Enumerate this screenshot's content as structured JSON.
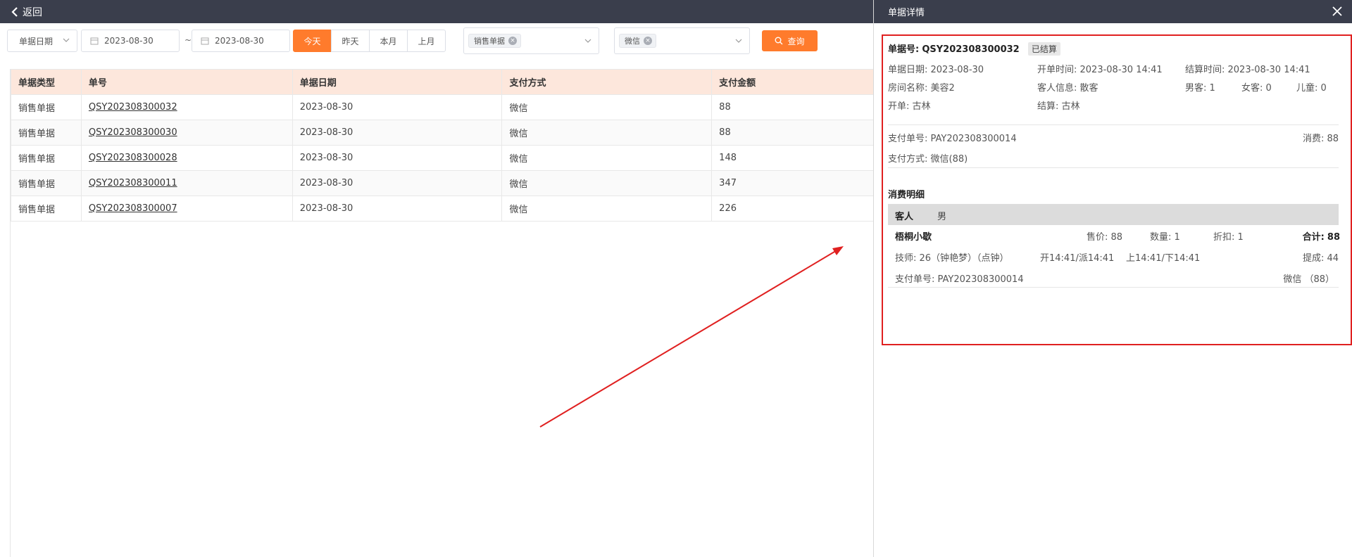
{
  "topbar": {
    "back_label": "返回"
  },
  "filters": {
    "date_type": "单据日期",
    "date_from": "2023-08-30",
    "date_sep": "~",
    "date_to": "2023-08-30",
    "quick": [
      "今天",
      "昨天",
      "本月",
      "上月"
    ],
    "doc_type_tag": "销售单据",
    "pay_tag": "微信",
    "query_label": "查询"
  },
  "table": {
    "headers": [
      "单据类型",
      "单号",
      "单据日期",
      "支付方式",
      "支付金额"
    ],
    "rows": [
      [
        "销售单据",
        "QSY202308300032",
        "2023-08-30",
        "微信",
        "88"
      ],
      [
        "销售单据",
        "QSY202308300030",
        "2023-08-30",
        "微信",
        "88"
      ],
      [
        "销售单据",
        "QSY202308300028",
        "2023-08-30",
        "微信",
        "148"
      ],
      [
        "销售单据",
        "QSY202308300011",
        "2023-08-30",
        "微信",
        "347"
      ],
      [
        "销售单据",
        "QSY202308300007",
        "2023-08-30",
        "微信",
        "226"
      ]
    ]
  },
  "panel": {
    "title": "单据详情",
    "doc_no_label": "单据号:",
    "doc_no": "QSY202308300032",
    "status": "已结算",
    "doc_date": "单据日期:  2023-08-30",
    "open_time": "开单时间:  2023-08-30 14:41",
    "settle_time": "结算时间:  2023-08-30 14:41",
    "room": "房间名称:  美容2",
    "guest_info": "客人信息:   散客",
    "male": "男客:  1",
    "female": "女客:  0",
    "child": "儿童:  0",
    "opener": "开单:  古林",
    "settler": "结算:  古林",
    "pay_no": "支付单号:  PAY202308300014",
    "consume": "消费:  88",
    "pay_method": "支付方式:  微信(88)",
    "detail_title": "消费明细",
    "guest_band_label": "客人",
    "guest_band_gender": "男",
    "item_name": "梧桐小歇",
    "price": "售价:  88",
    "qty": "数量:  1",
    "discount": "折扣:  1",
    "total_label": "合计:",
    "total": "88",
    "tech": "技师:  26（钟艳梦）（点钟）",
    "open_dispatch": "开14:41/派14:41",
    "up_down": "上14:41/下14:41",
    "commission": "提成:  44",
    "item_pay_no": "支付单号:  PAY202308300014",
    "item_pay": "微信  （88）"
  },
  "colors": {
    "accent": "#ff7b2c",
    "header_bg": "#3a3e4c",
    "table_head": "#fde7dc",
    "annotation": "#e02020"
  }
}
